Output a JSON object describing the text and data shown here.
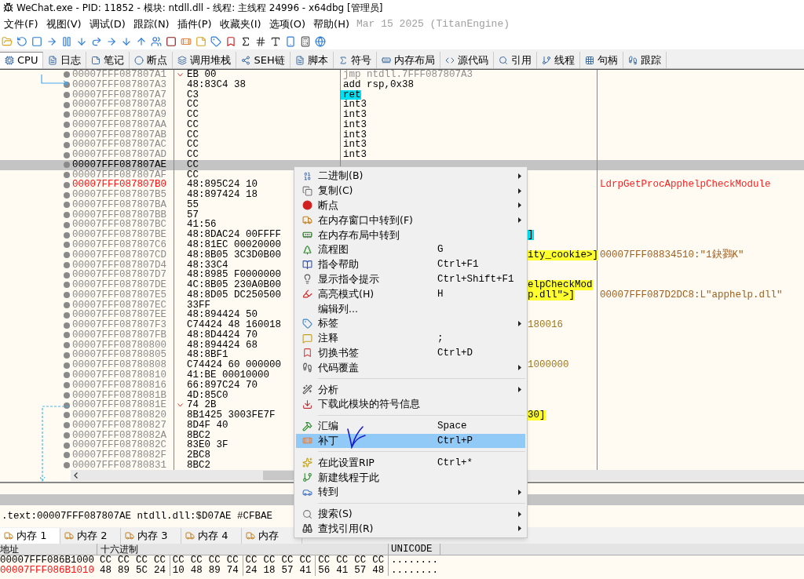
{
  "window": {
    "title": "WeChat.exe - PID: 11852 - 模块: ntdll.dll - 线程: 主线程 24996 - x64dbg [管理员]"
  },
  "menu": [
    "文件(F)",
    "视图(V)",
    "调试(D)",
    "跟踪(N)",
    "插件(P)",
    "收藏夹(I)",
    "选项(O)",
    "帮助(H)"
  ],
  "build_info": "Mar 15 2025 (TitanEngine)",
  "tabs": [
    {
      "label": "CPU",
      "selected": true
    },
    {
      "label": "日志",
      "selected": false
    },
    {
      "label": "笔记",
      "selected": false
    },
    {
      "label": "断点",
      "selected": false
    },
    {
      "label": "调用堆栈",
      "selected": false
    },
    {
      "label": "SEH链",
      "selected": false
    },
    {
      "label": "脚本",
      "selected": false
    },
    {
      "label": "符号",
      "selected": false
    },
    {
      "label": "内存布局",
      "selected": false
    },
    {
      "label": "源代码",
      "selected": false
    },
    {
      "label": "引用",
      "selected": false
    },
    {
      "label": "线程",
      "selected": false
    },
    {
      "label": "句柄",
      "selected": false
    },
    {
      "label": "跟踪",
      "selected": false
    }
  ],
  "disassembly": [
    {
      "address": "00007FFF087807A1",
      "kind": "normal",
      "jump": true,
      "bytes": "EB 00",
      "instruction": {
        "text": "jmp ntdll.7FFF087807A3",
        "kind": "jump"
      }
    },
    {
      "address": "00007FFF087807A3",
      "kind": "normal",
      "jump": false,
      "bytes": "48:83C4 38",
      "instruction": {
        "text": "add rsp,0x38",
        "kind": "normal"
      }
    },
    {
      "address": "00007FFF087807A7",
      "kind": "normal",
      "jump": false,
      "bytes": "C3",
      "instruction": {
        "text": "ret",
        "kind": "highlighted"
      }
    },
    {
      "address": "00007FFF087807A8",
      "kind": "normal",
      "jump": false,
      "bytes": "CC",
      "instruction": {
        "text": "int3",
        "kind": "normal"
      }
    },
    {
      "address": "00007FFF087807A9",
      "kind": "normal",
      "jump": false,
      "bytes": "CC",
      "instruction": {
        "text": "int3",
        "kind": "normal"
      }
    },
    {
      "address": "00007FFF087807AA",
      "kind": "normal",
      "jump": false,
      "bytes": "CC",
      "instruction": {
        "text": "int3",
        "kind": "normal"
      }
    },
    {
      "address": "00007FFF087807AB",
      "kind": "normal",
      "jump": false,
      "bytes": "CC",
      "instruction": {
        "text": "int3",
        "kind": "normal"
      }
    },
    {
      "address": "00007FFF087807AC",
      "kind": "normal",
      "jump": false,
      "bytes": "CC",
      "instruction": {
        "text": "int3",
        "kind": "normal"
      }
    },
    {
      "address": "00007FFF087807AD",
      "kind": "normal",
      "jump": false,
      "bytes": "CC",
      "instruction": {
        "text": "int3",
        "kind": "normal"
      }
    },
    {
      "address": "00007FFF087807AE",
      "kind": "selected",
      "jump": false,
      "bytes": "CC"
    },
    {
      "address": "00007FFF087807AF",
      "kind": "normal",
      "jump": false,
      "bytes": "CC"
    },
    {
      "address": "00007FFF087807B0",
      "kind": "label",
      "jump": false,
      "bytes": "48:895C24 10",
      "comment": {
        "text": "LdrpGetProcApphelpCheckModule",
        "kind": "label"
      }
    },
    {
      "address": "00007FFF087807B5",
      "kind": "normal",
      "jump": false,
      "bytes": "48:897424 18"
    },
    {
      "address": "00007FFF087807BA",
      "kind": "normal",
      "jump": false,
      "bytes": "55"
    },
    {
      "address": "00007FFF087807BB",
      "kind": "normal",
      "jump": false,
      "bytes": "57"
    },
    {
      "address": "00007FFF087807BC",
      "kind": "normal",
      "jump": false,
      "bytes": "41:56"
    },
    {
      "address": "00007FFF087807BE",
      "kind": "normal",
      "jump": false,
      "bytes": "48:8DAC24 00FFFF",
      "operand": {
        "text": "]",
        "kind": "register"
      }
    },
    {
      "address": "00007FFF087807C6",
      "kind": "normal",
      "jump": false,
      "bytes": "48:81EC 00020000"
    },
    {
      "address": "00007FFF087807CD",
      "kind": "normal",
      "jump": false,
      "bytes": "48:8B05 3C3D0B00",
      "operand": {
        "text": "ity_cookie>]",
        "kind": "symbol"
      },
      "comment": {
        "text": "00007FFF08834510:\"1鈌鷚K\"",
        "kind": "string"
      }
    },
    {
      "address": "00007FFF087807D4",
      "kind": "normal",
      "jump": false,
      "bytes": "48:33C4"
    },
    {
      "address": "00007FFF087807D7",
      "kind": "normal",
      "jump": false,
      "bytes": "48:8985 F0000000"
    },
    {
      "address": "00007FFF087807DE",
      "kind": "normal",
      "jump": false,
      "bytes": "4C:8B05 230A0B00",
      "operand": {
        "text": "elpCheckMod",
        "kind": "symbol"
      }
    },
    {
      "address": "00007FFF087807E5",
      "kind": "normal",
      "jump": false,
      "bytes": "48:8D05 DC250500",
      "operand": {
        "text": "p.dll\">]",
        "kind": "symbol"
      },
      "comment": {
        "text": "00007FFF087D2DC8:L\"apphelp.dll\"",
        "kind": "string"
      }
    },
    {
      "address": "00007FFF087807EC",
      "kind": "normal",
      "jump": false,
      "bytes": "33FF"
    },
    {
      "address": "00007FFF087807EE",
      "kind": "normal",
      "jump": false,
      "bytes": "48:894424 50"
    },
    {
      "address": "00007FFF087807F3",
      "kind": "normal",
      "jump": false,
      "bytes": "C74424 48 160018",
      "operand": {
        "text": "180016",
        "kind": "number"
      }
    },
    {
      "address": "00007FFF087807FB",
      "kind": "normal",
      "jump": false,
      "bytes": "48:8D4424 70"
    },
    {
      "address": "00007FFF08780800",
      "kind": "normal",
      "jump": false,
      "bytes": "48:894424 68"
    },
    {
      "address": "00007FFF08780805",
      "kind": "normal",
      "jump": false,
      "bytes": "48:8BF1"
    },
    {
      "address": "00007FFF08780808",
      "kind": "normal",
      "jump": false,
      "bytes": "C74424 60 000000",
      "operand": {
        "text": "1000000",
        "kind": "number"
      }
    },
    {
      "address": "00007FFF08780810",
      "kind": "normal",
      "jump": false,
      "bytes": "41:BE 00010000"
    },
    {
      "address": "00007FFF08780816",
      "kind": "normal",
      "jump": false,
      "bytes": "66:897C24 70"
    },
    {
      "address": "00007FFF0878081B",
      "kind": "normal",
      "jump": false,
      "bytes": "4D:85C0"
    },
    {
      "address": "00007FFF0878081E",
      "kind": "normal",
      "jump": true,
      "bytes": "74 2B"
    },
    {
      "address": "00007FFF08780820",
      "kind": "normal",
      "jump": false,
      "bytes": "8B1425 3003FE7F",
      "operand": {
        "text": "30]",
        "kind": "symbol"
      }
    },
    {
      "address": "00007FFF08780827",
      "kind": "normal",
      "jump": false,
      "bytes": "8D4F 40"
    },
    {
      "address": "00007FFF0878082A",
      "kind": "normal",
      "jump": false,
      "bytes": "8BC2"
    },
    {
      "address": "00007FFF0878082C",
      "kind": "normal",
      "jump": false,
      "bytes": "83E0 3F"
    },
    {
      "address": "00007FFF0878082F",
      "kind": "normal",
      "jump": false,
      "bytes": "2BC8"
    },
    {
      "address": "00007FFF08780831",
      "kind": "normal",
      "jump": false,
      "bytes": "8BC2"
    }
  ],
  "info_line": ".text:00007FFF087807AE ntdll.dll:$D07AE #CFBAE",
  "memory_tabs": [
    {
      "label": "内存 1",
      "selected": true
    },
    {
      "label": "内存 2",
      "selected": false
    },
    {
      "label": "内存 3",
      "selected": false
    },
    {
      "label": "内存 4",
      "selected": false
    },
    {
      "label": "内存",
      "selected": false
    }
  ],
  "hex": {
    "columns": [
      "地址",
      "十六进制",
      "UNICODE"
    ],
    "rows": [
      {
        "address": "00007FFF086B1000",
        "kind": "normal",
        "bytes": [
          "CC",
          "CC",
          "CC",
          "CC",
          "CC",
          "CC",
          "CC",
          "CC",
          "CC",
          "CC",
          "CC",
          "CC",
          "CC",
          "CC",
          "CC",
          "CC"
        ],
        "text": "........"
      },
      {
        "address": "00007FFF086B1010",
        "kind": "label",
        "bytes": [
          "48",
          "89",
          "5C",
          "24",
          "10",
          "48",
          "89",
          "74",
          "24",
          "18",
          "57",
          "41",
          "56",
          "41",
          "57",
          "48"
        ],
        "text": "........"
      }
    ]
  },
  "context_menu": [
    {
      "kind": "item",
      "label": "二进制(B)",
      "submenu": true,
      "selected": false
    },
    {
      "kind": "item",
      "label": "复制(C)",
      "submenu": true,
      "selected": false
    },
    {
      "kind": "item",
      "label": "断点",
      "submenu": true,
      "selected": false
    },
    {
      "kind": "item",
      "label": "在内存窗口中转到(F)",
      "submenu": true,
      "selected": false
    },
    {
      "kind": "item",
      "label": "在内存布局中转到",
      "submenu": false,
      "selected": false
    },
    {
      "kind": "item",
      "label": "流程图",
      "shortcut": "G",
      "submenu": false,
      "selected": false
    },
    {
      "kind": "item",
      "label": "指令帮助",
      "shortcut": "Ctrl+F1",
      "submenu": false,
      "selected": false
    },
    {
      "kind": "item",
      "label": "显示指令提示",
      "shortcut": "Ctrl+Shift+F1",
      "submenu": false,
      "selected": false
    },
    {
      "kind": "item",
      "label": "高亮模式(H)",
      "shortcut": "H",
      "submenu": false,
      "selected": false
    },
    {
      "kind": "item",
      "label": "编辑列...",
      "submenu": false,
      "selected": false
    },
    {
      "kind": "item",
      "label": "标签",
      "submenu": true,
      "selected": false
    },
    {
      "kind": "item",
      "label": "注释",
      "shortcut": ";",
      "submenu": false,
      "selected": false
    },
    {
      "kind": "item",
      "label": "切换书签",
      "shortcut": "Ctrl+D",
      "submenu": false,
      "selected": false
    },
    {
      "kind": "item",
      "label": "代码覆盖",
      "submenu": true,
      "selected": false
    },
    {
      "kind": "separator"
    },
    {
      "kind": "item",
      "label": "分析",
      "submenu": true,
      "selected": false
    },
    {
      "kind": "item",
      "label": "下载此模块的符号信息",
      "submenu": false,
      "selected": false
    },
    {
      "kind": "separator"
    },
    {
      "kind": "item",
      "label": "汇编",
      "shortcut": "Space",
      "submenu": false,
      "selected": false
    },
    {
      "kind": "item",
      "label": "补丁",
      "shortcut": "Ctrl+P",
      "submenu": false,
      "selected": true
    },
    {
      "kind": "separator"
    },
    {
      "kind": "item",
      "label": "在此设置RIP",
      "shortcut": "Ctrl+*",
      "submenu": false,
      "selected": false
    },
    {
      "kind": "item",
      "label": "新建线程于此",
      "submenu": false,
      "selected": false
    },
    {
      "kind": "item",
      "label": "转到",
      "submenu": true,
      "selected": false
    },
    {
      "kind": "separator"
    },
    {
      "kind": "item",
      "label": "搜索(S)",
      "submenu": true,
      "selected": false
    },
    {
      "kind": "item",
      "label": "查找引用(R)",
      "submenu": true,
      "selected": false
    }
  ]
}
